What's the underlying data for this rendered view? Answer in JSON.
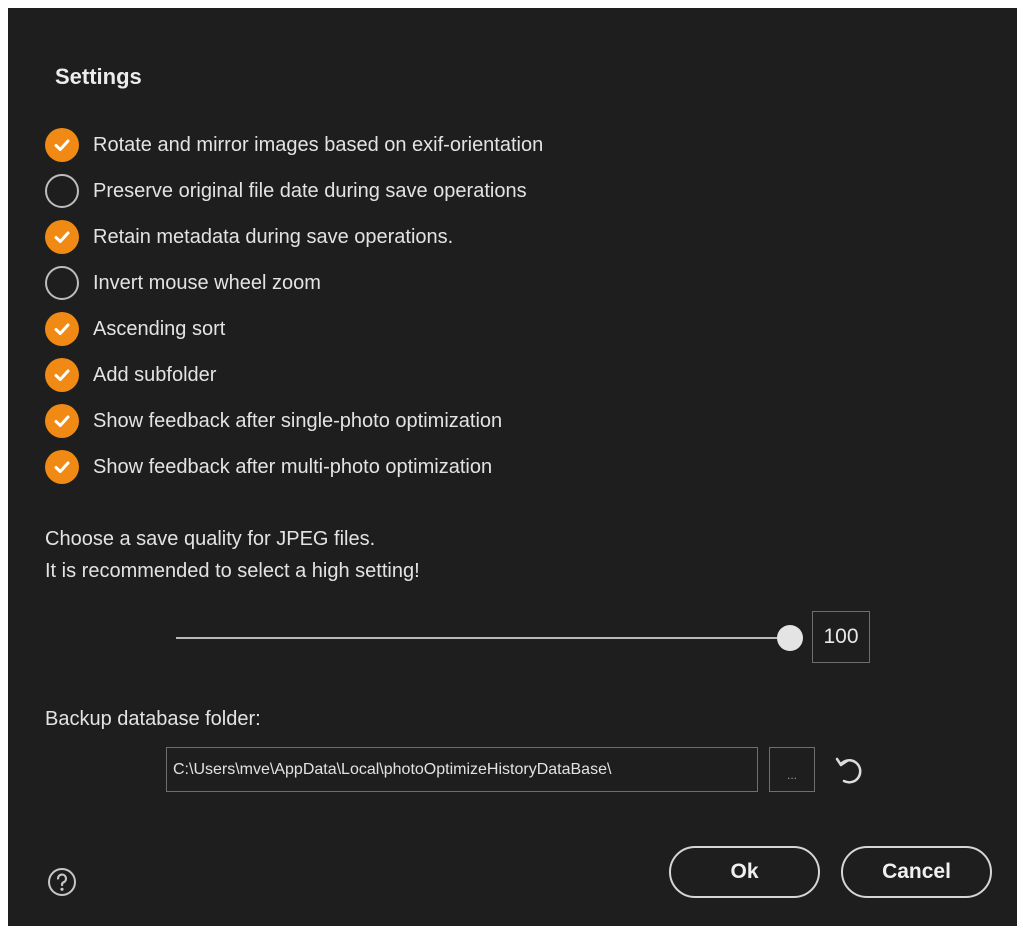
{
  "dialog": {
    "title": "Settings"
  },
  "options": [
    {
      "label": "Rotate and mirror images based on exif-orientation",
      "checked": true
    },
    {
      "label": "Preserve original file date during save operations",
      "checked": false
    },
    {
      "label": "Retain metadata during save operations.",
      "checked": true
    },
    {
      "label": "Invert mouse wheel zoom",
      "checked": false
    },
    {
      "label": "Ascending sort",
      "checked": true
    },
    {
      "label": "Add subfolder",
      "checked": true
    },
    {
      "label": "Show feedback after single-photo optimization",
      "checked": true
    },
    {
      "label": "Show feedback after multi-photo optimization",
      "checked": true
    }
  ],
  "quality": {
    "line1": "Choose a save quality for JPEG files.",
    "line2": "It is recommended to select a high setting!",
    "value": "100",
    "slider_fraction": 1.0
  },
  "backup": {
    "label": "Backup database folder:",
    "path": "C:\\Users\\mve\\AppData\\Local\\photoOptimizeHistoryDataBase\\",
    "browse_label": "..."
  },
  "buttons": {
    "ok": "Ok",
    "cancel": "Cancel"
  },
  "icons": {
    "help": "help-icon",
    "reset": "undo-icon",
    "check": "check-icon"
  },
  "colors": {
    "accent": "#f08a14",
    "background": "#1e1e1e"
  }
}
